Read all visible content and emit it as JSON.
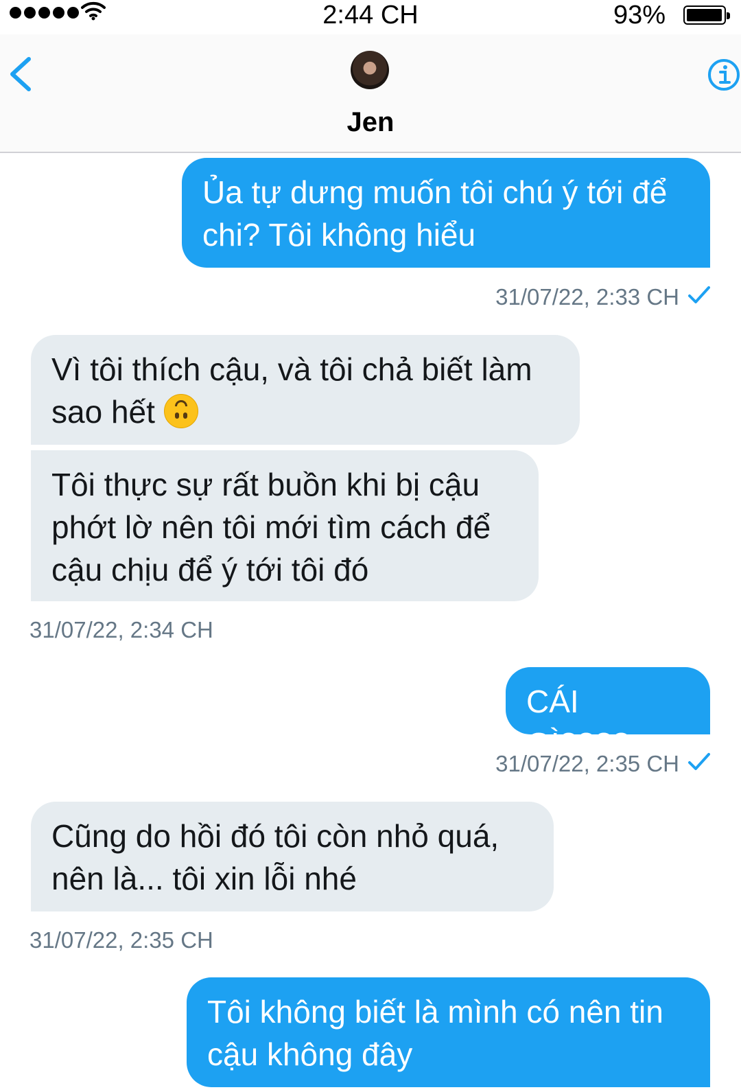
{
  "status_bar": {
    "time": "2:44 CH",
    "battery": "93%"
  },
  "header": {
    "contact_name": "Jen",
    "back_icon": "chevron-left-icon",
    "info_icon": "info-icon"
  },
  "colors": {
    "accent": "#1da1f2",
    "incoming_bubble": "#e6ecf0",
    "timestamp": "#657786"
  },
  "messages": [
    {
      "direction": "out",
      "text": "Ủa tự dưng muốn tôi chú ý tới để chi? Tôi không hiểu"
    },
    {
      "direction": "meta",
      "timestamp": "31/07/22, 2:33 CH",
      "status": "sent"
    },
    {
      "direction": "in",
      "text": "Vì tôi thích cậu, và tôi chả biết làm sao hết",
      "emoji": "upside-down-face-icon"
    },
    {
      "direction": "in",
      "text": "Tôi thực sự rất buồn khi bị cậu phớt lờ nên tôi mới tìm cách để cậu chịu để ý tới tôi đó"
    },
    {
      "direction": "meta",
      "timestamp": "31/07/22, 2:34 CH"
    },
    {
      "direction": "out",
      "text": "CÁI GÌ????"
    },
    {
      "direction": "meta",
      "timestamp": "31/07/22, 2:35 CH",
      "status": "sent"
    },
    {
      "direction": "in",
      "text": "Cũng do hồi đó tôi còn nhỏ quá, nên là... tôi xin lỗi nhé"
    },
    {
      "direction": "meta",
      "timestamp": "31/07/22, 2:35 CH"
    },
    {
      "direction": "out",
      "text": "Tôi không biết là mình có nên tin cậu không đây"
    }
  ]
}
